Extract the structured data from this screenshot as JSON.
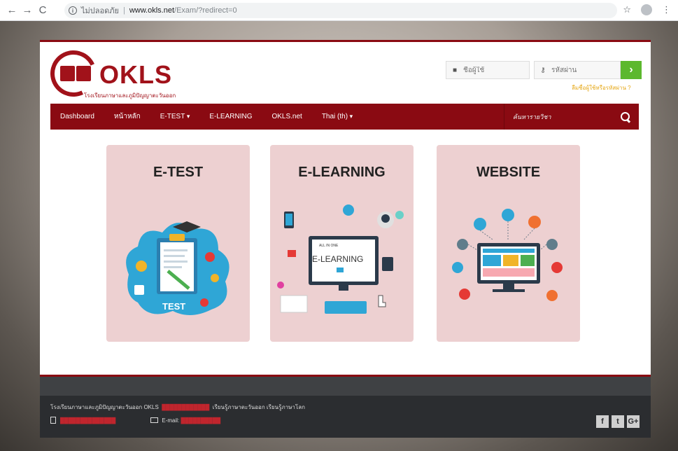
{
  "browser": {
    "security_label": "ไม่ปลอดภัย",
    "url_host": "www.okls.net",
    "url_path": "/Exam/?redirect=0"
  },
  "header": {
    "logo_text": "OKLS",
    "logo_subtitle": "โรงเรียนภาษาและภูมิปัญญาตะวันออก",
    "username_placeholder": "ชื่อผู้ใช้",
    "password_placeholder": "รหัสผ่าน",
    "forgot_label": "ลืมชื่อผู้ใช้หรือรหัสผ่าน ?"
  },
  "nav": {
    "items": [
      "Dashboard",
      "หน้าหลัก",
      "E-TEST",
      "E-LEARNING",
      "OKLS.net",
      "Thai (th)"
    ],
    "search_placeholder": "ค้นหารายวิชา"
  },
  "cards": [
    {
      "title": "E-TEST",
      "caption": "TEST"
    },
    {
      "title": "E-LEARNING",
      "caption": "E-LEARNING",
      "badge": "ALL IN ONE"
    },
    {
      "title": "WEBSITE"
    }
  ],
  "footer": {
    "school_name": "โรงเรียนภาษาและภูมิปัญญาตะวันออก OKLS",
    "tagline": "เรียนรู้ภาษาตะวันออก เรียนรู้ภาษาโลก",
    "email_label": "E-mail:",
    "social": [
      "f",
      "t",
      "G+"
    ]
  },
  "colors": {
    "brand": "#8a0a12",
    "card_bg": "#edd0d1",
    "go_button": "#5cb82e"
  }
}
